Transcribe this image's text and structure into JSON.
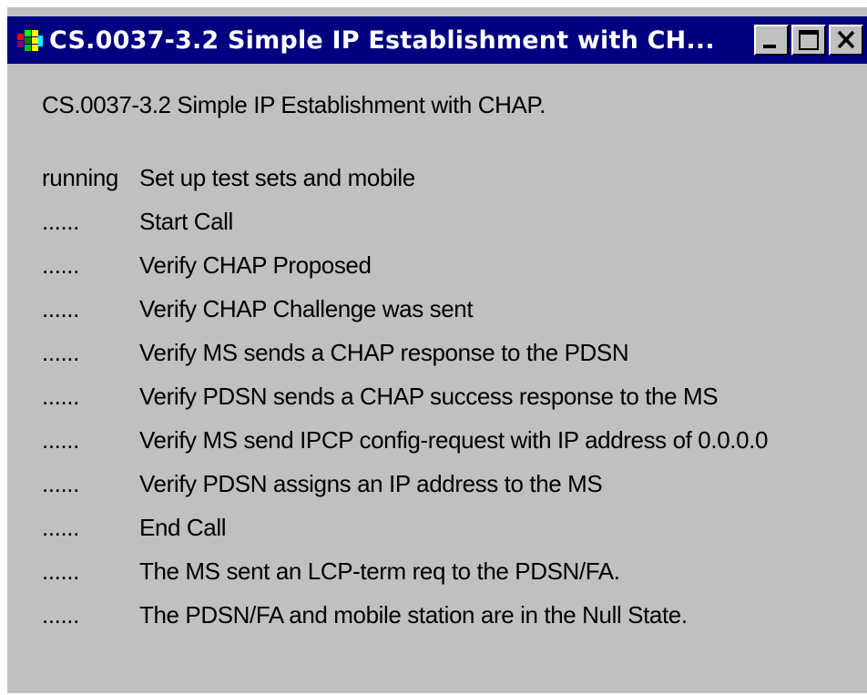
{
  "window": {
    "title": "CS.0037-3.2 Simple IP Establishment with CH...",
    "icon": "test-app-icon",
    "controls": {
      "minimize_icon": "minimize-icon",
      "maximize_icon": "maximize-icon",
      "close_icon": "close-icon"
    }
  },
  "content": {
    "heading": "CS.0037-3.2 Simple IP Establishment with CHAP.",
    "steps": [
      {
        "status": "running",
        "text": "Set up test sets and mobile"
      },
      {
        "status": "......",
        "text": "Start Call"
      },
      {
        "status": "......",
        "text": "Verify CHAP Proposed"
      },
      {
        "status": "......",
        "text": "Verify CHAP Challenge was sent"
      },
      {
        "status": "......",
        "text": "Verify MS sends a CHAP response to the PDSN"
      },
      {
        "status": "......",
        "text": "Verify PDSN sends a CHAP success response to the MS"
      },
      {
        "status": "......",
        "text": "Verify MS send IPCP config-request with IP address of 0.0.0.0"
      },
      {
        "status": "......",
        "text": "Verify PDSN assigns an IP address to the MS"
      },
      {
        "status": "......",
        "text": "End Call"
      },
      {
        "status": "......",
        "text": "The MS sent an LCP-term req to the PDSN/FA."
      },
      {
        "status": "......",
        "text": "The PDSN/FA and mobile station are in the Null State."
      }
    ]
  },
  "colors": {
    "titlebar": "#000080",
    "window_face": "#c0c0c0",
    "title_text": "#ffffff"
  }
}
